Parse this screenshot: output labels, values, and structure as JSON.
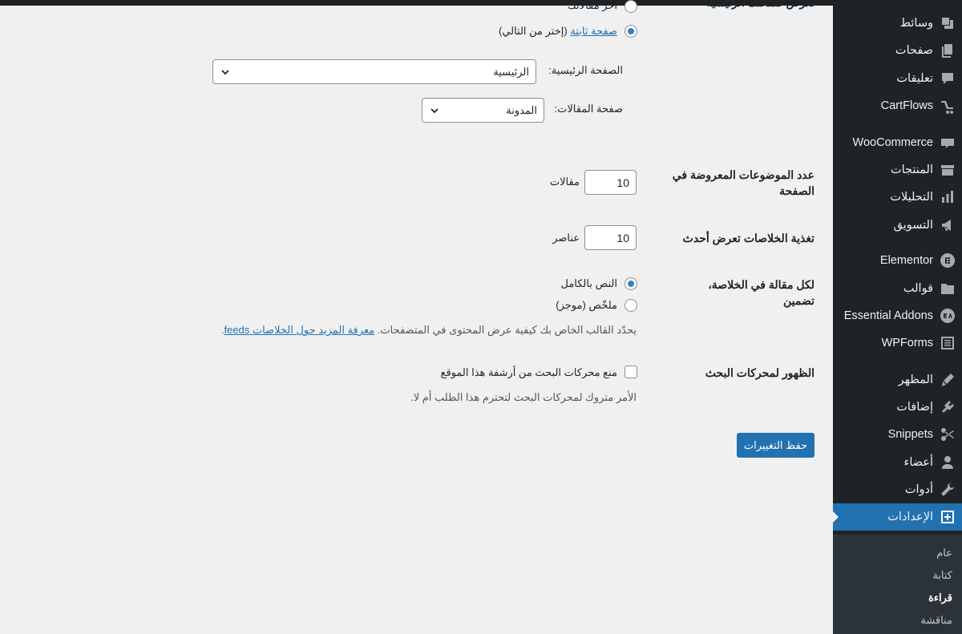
{
  "sidebar": {
    "items": [
      {
        "label": "وسائط",
        "icon": "media-icon"
      },
      {
        "label": "صفحات",
        "icon": "pages-icon"
      },
      {
        "label": "تعليقات",
        "icon": "comments-icon"
      },
      {
        "label": "CartFlows",
        "icon": "cartflows-icon"
      },
      {
        "label": "WooCommerce",
        "icon": "woocommerce-icon"
      },
      {
        "label": "المنتجات",
        "icon": "products-icon"
      },
      {
        "label": "التحليلات",
        "icon": "analytics-icon"
      },
      {
        "label": "التسويق",
        "icon": "marketing-icon"
      },
      {
        "label": "Elementor",
        "icon": "elementor-icon"
      },
      {
        "label": "قوالب",
        "icon": "templates-icon"
      },
      {
        "label": "Essential Addons",
        "icon": "essential-addons-icon"
      },
      {
        "label": "WPForms",
        "icon": "wpforms-icon"
      },
      {
        "label": "المظهر",
        "icon": "appearance-icon"
      },
      {
        "label": "إضافات",
        "icon": "plugins-icon"
      },
      {
        "label": "Snippets",
        "icon": "snippets-icon"
      },
      {
        "label": "أعضاء",
        "icon": "users-icon"
      },
      {
        "label": "أدوات",
        "icon": "tools-icon"
      },
      {
        "label": "الإعدادات",
        "icon": "settings-icon"
      }
    ],
    "submenu": [
      "عام",
      "كتابة",
      "قراءة",
      "مناقشة"
    ]
  },
  "form": {
    "homepage_display": {
      "label": "تعرض صفحتك الرئيسية",
      "option_latest": "آخر مقالاتك",
      "option_static": "صفحة ثابتة",
      "option_static_hint": "(إختر من التالي)",
      "homepage_label": "الصفحة الرئيسية:",
      "homepage_value": "الرئيسية",
      "posts_page_label": "صفحة المقالات:",
      "posts_page_value": "المدونة"
    },
    "posts_per_page": {
      "label": "عدد الموضوعات المعروضة في الصفحة",
      "value": "10",
      "unit": "مقالات"
    },
    "feed_items": {
      "label": "تغذية الخلاصات تعرض أحدث",
      "value": "10",
      "unit": "عناصر"
    },
    "feed_content": {
      "label": "لكل مقالة في الخلاصة، تضمين",
      "option_full": "النص بالكامل",
      "option_excerpt": "ملخّص (موجز)",
      "description": "يحدّد القالب الخاص بك كيفية عرض المحتوى في المتصفحات.",
      "learn_more": "معرفة المزيد حول الخلاصات feeds",
      "trailing": "."
    },
    "search_visibility": {
      "label": "الظهور لمحركات البحث",
      "checkbox_label": "منع محركات البحث من أرشفة هذا الموقع",
      "description": "الأمر متروك لمحركات البحث لتحترم هذا الطلب أم لا."
    },
    "save_label": "حفظ التغييرات"
  },
  "colors": {
    "sidebar_bg": "#1d2327",
    "accent": "#2271b1",
    "page_bg": "#f0f0f1"
  }
}
